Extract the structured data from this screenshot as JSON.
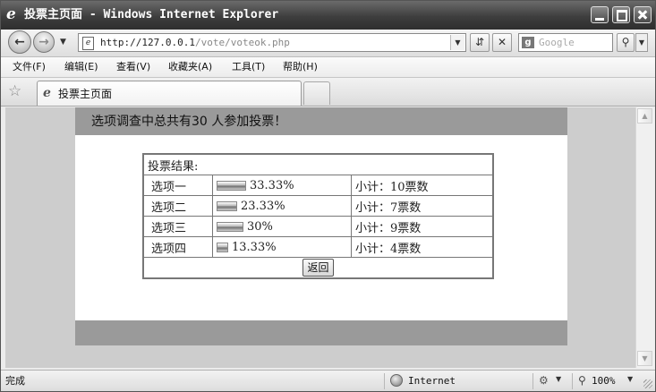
{
  "window": {
    "title": "投票主页面 - Windows Internet Explorer"
  },
  "toolbar": {
    "back_icon": "back-arrow-icon",
    "forward_icon": "forward-arrow-icon",
    "address_url_host": "http://127.0.0.1",
    "address_url_path": "/vote/voteok.php",
    "search_placeholder": "Google"
  },
  "menu": {
    "items": [
      {
        "label": "文件(F)"
      },
      {
        "label": "编辑(E)"
      },
      {
        "label": "查看(V)"
      },
      {
        "label": "收藏夹(A)"
      },
      {
        "label": "工具(T)"
      },
      {
        "label": "帮助(H)"
      }
    ]
  },
  "tabs": {
    "active_label": "投票主页面"
  },
  "page": {
    "header": "选项调查中总共有30 人参加投票！",
    "results_title": "投票结果:",
    "rows": [
      {
        "option": "选项一",
        "percent_text": "33.33%",
        "percent": 33.33,
        "subtotal": "小计：10票数"
      },
      {
        "option": "选项二",
        "percent_text": "23.33%",
        "percent": 23.33,
        "subtotal": "小计：7票数"
      },
      {
        "option": "选项三",
        "percent_text": "30%",
        "percent": 30,
        "subtotal": "小计：9票数"
      },
      {
        "option": "选项四",
        "percent_text": "13.33%",
        "percent": 13.33,
        "subtotal": "小计：4票数"
      }
    ],
    "return_button": "返回"
  },
  "status": {
    "left_text": "完成",
    "zone": "Internet",
    "zoom": "100%"
  },
  "colors": {
    "header_band": "#9a9a9a",
    "viewport_bg": "#cdcdcd",
    "table_border": "#777777"
  }
}
